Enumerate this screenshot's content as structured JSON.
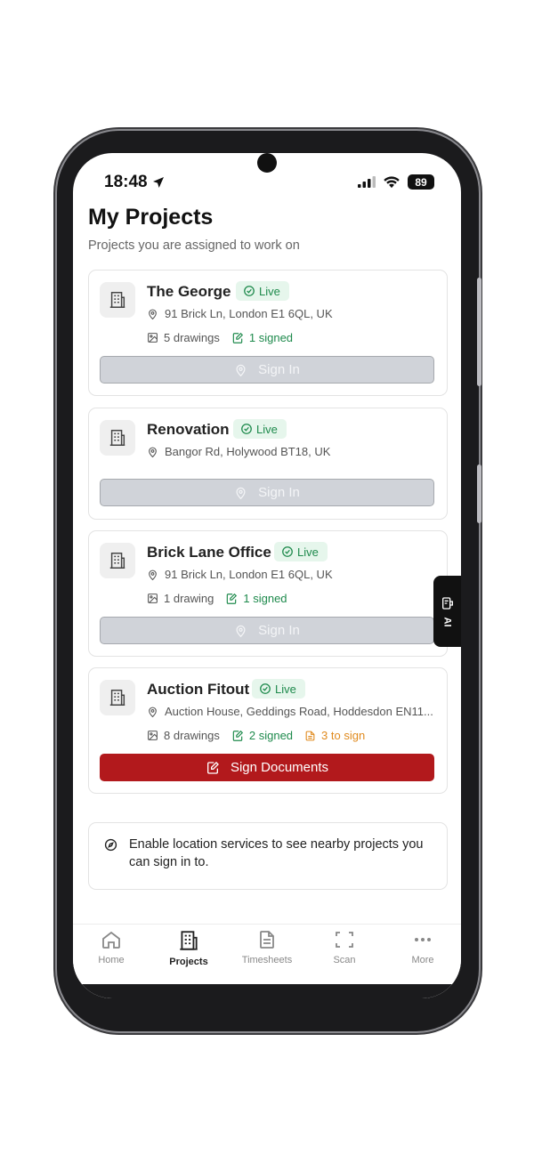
{
  "status": {
    "time": "18:48",
    "battery": "89"
  },
  "header": {
    "title": "My Projects",
    "subtitle": "Projects you are assigned to work on"
  },
  "projects": [
    {
      "name": "The George",
      "badge": "Live",
      "address": "91 Brick Ln, London E1 6QL, UK",
      "drawings": "5 drawings",
      "signed": "1 signed",
      "to_sign": "",
      "action": "Sign In",
      "action_enabled": false
    },
    {
      "name": "Renovation",
      "badge": "Live",
      "address": "Bangor Rd, Holywood BT18, UK",
      "drawings": "",
      "signed": "",
      "to_sign": "",
      "action": "Sign In",
      "action_enabled": false
    },
    {
      "name": "Brick Lane Office",
      "badge": "Live",
      "address": "91 Brick Ln, London E1 6QL, UK",
      "drawings": "1 drawing",
      "signed": "1 signed",
      "to_sign": "",
      "action": "Sign In",
      "action_enabled": false
    },
    {
      "name": "Auction Fitout",
      "badge": "Live",
      "address": "Auction House, Geddings Road, Hoddesdon EN11...",
      "drawings": "8 drawings",
      "signed": "2 signed",
      "to_sign": "3 to sign",
      "action": "Sign Documents",
      "action_enabled": true
    }
  ],
  "notice": {
    "text": "Enable location services to see nearby projects you can sign in to."
  },
  "ai_tab": {
    "label": "AI"
  },
  "tabs": [
    {
      "label": "Home",
      "icon": "home-icon",
      "active": false
    },
    {
      "label": "Projects",
      "icon": "building-icon",
      "active": true
    },
    {
      "label": "Timesheets",
      "icon": "document-icon",
      "active": false
    },
    {
      "label": "Scan",
      "icon": "scan-icon",
      "active": false
    },
    {
      "label": "More",
      "icon": "more-icon",
      "active": false
    }
  ],
  "colors": {
    "primary": "#b2191c",
    "live_green": "#1e8a4c",
    "pending_orange": "#e08a1e",
    "disabled": "#d0d3d9"
  }
}
